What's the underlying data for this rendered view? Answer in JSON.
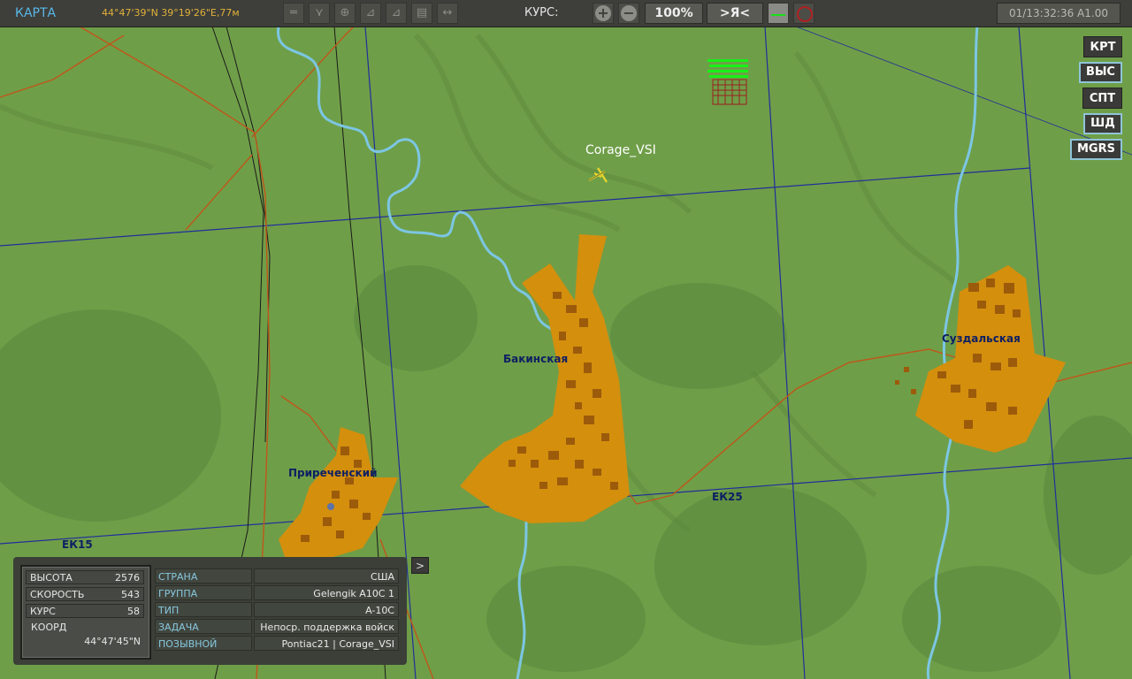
{
  "topbar": {
    "mode": "КАРТА",
    "coords": "44°47'39\"N 39°19'26\"E,77м",
    "course_label": "КУРС:",
    "zoom_in": "+",
    "zoom_out": "−",
    "zoom": "100%",
    "center_me": ">Я<",
    "time": "01/13:32:36 A1.00"
  },
  "right_buttons": [
    {
      "label": "КРТ",
      "selected": false
    },
    {
      "label": "ВЫС",
      "selected": true
    },
    {
      "label": "СПТ",
      "selected": false
    },
    {
      "label": "ШД",
      "selected": true
    },
    {
      "label": "MGRS",
      "selected": true
    }
  ],
  "map": {
    "player_label": "Corage_VSI",
    "towns": [
      "Бакинская",
      "Суздальская",
      "Приреченский"
    ],
    "grid_labels": [
      "ЕК15",
      "ЕК25"
    ],
    "colors": {
      "terrain": "#6f9e48",
      "town": "#d48f0d",
      "river": "#7cc6e3",
      "grid": "#1f2f9a",
      "road": "#c0561a"
    }
  },
  "panel": {
    "left": [
      {
        "key": "ВЫСОТА",
        "value": "2576"
      },
      {
        "key": "СКОРОСТЬ",
        "value": "543"
      },
      {
        "key": "КУРС",
        "value": "58"
      },
      {
        "key": "КООРД",
        "value": "44°47'45\"N"
      }
    ],
    "right": [
      {
        "key": "СТРАНА",
        "value": "США"
      },
      {
        "key": "ГРУППА",
        "value": "Gelengik A10C 1"
      },
      {
        "key": "ТИП",
        "value": "A-10C"
      },
      {
        "key": "ЗАДАЧА",
        "value": "Непоср. поддержка войск"
      },
      {
        "key": "ПОЗЫВНОЙ",
        "value": "Pontiac21 | Corage_VSI"
      }
    ],
    "expand": ">"
  }
}
